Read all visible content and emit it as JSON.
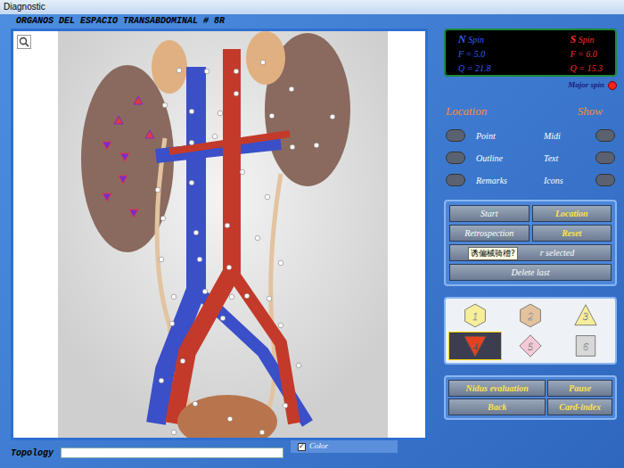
{
  "window": {
    "title": "Diagnostic"
  },
  "organ_view": {
    "title": "ORGANOS DEL ESPACIO TRANSABDOMINAL # 8R"
  },
  "spin": [
    {
      "pole": "N",
      "name": "Spin",
      "f": "F = 5.0",
      "q": "Q = 21.8",
      "color": "#2f5cff"
    },
    {
      "pole": "S",
      "name": "Spin",
      "f": "F = 6.0",
      "q": "Q = 15.3",
      "color": "#ff2a2a"
    }
  ],
  "major_spin": {
    "label": "Major spin",
    "on": true
  },
  "location": {
    "title": "Location",
    "options": [
      {
        "label": "Point",
        "selected": false
      },
      {
        "label": "Outline",
        "selected": false
      },
      {
        "label": "Remarks",
        "selected": false
      }
    ]
  },
  "show": {
    "title": "Show",
    "options": [
      {
        "label": "Midi",
        "selected": false
      },
      {
        "label": "Text",
        "selected": false
      },
      {
        "label": "Icons",
        "selected": false
      }
    ]
  },
  "control_buttons": [
    {
      "label": "Start",
      "highlight": false
    },
    {
      "label": "Location",
      "highlight": true
    },
    {
      "label": "Retrospection",
      "highlight": false
    },
    {
      "label": "Reset",
      "highlight": true
    }
  ],
  "wide_buttons": [
    {
      "label": "r selected"
    },
    {
      "label": "Delete last"
    }
  ],
  "tooltip": "诱偏械骑稽?",
  "marker_types": [
    {
      "label": "1",
      "kind": "hexagon",
      "color": "#f7ee9a",
      "selected": false
    },
    {
      "label": "2",
      "kind": "hexagon",
      "color": "#e3c29e",
      "selected": false
    },
    {
      "label": "3",
      "kind": "triangle",
      "color": "#f7ee9a",
      "selected": false
    },
    {
      "label": "4",
      "kind": "inverted",
      "color": "#e6411f",
      "selected": true
    },
    {
      "label": "5",
      "kind": "diamond",
      "color": "#f7c9d6",
      "selected": false
    },
    {
      "label": "6",
      "kind": "square",
      "color": "#d8d8d8",
      "selected": false
    }
  ],
  "bottom_buttons": [
    "Nidus evaluation",
    "Pause",
    "Back",
    "Card-index"
  ],
  "color_toggle": {
    "label": "Color",
    "checked": true
  },
  "topology": {
    "label": "Topology"
  }
}
